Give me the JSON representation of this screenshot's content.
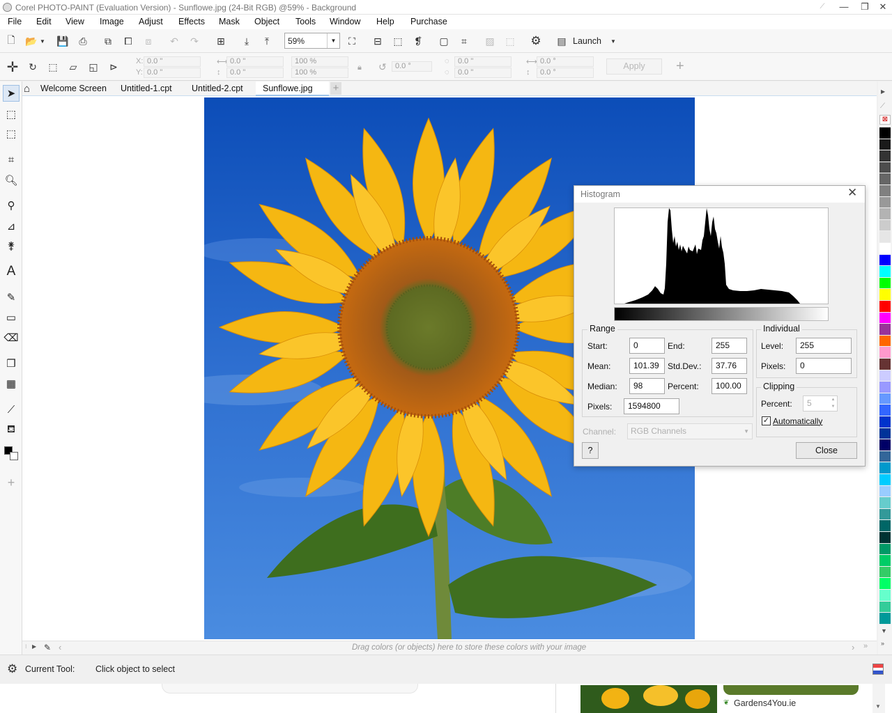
{
  "window": {
    "title": "Corel PHOTO-PAINT (Evaluation Version) - Sunflowe.jpg (24-Bit RGB) @59% - Background"
  },
  "menu": [
    "File",
    "Edit",
    "View",
    "Image",
    "Adjust",
    "Effects",
    "Mask",
    "Object",
    "Tools",
    "Window",
    "Help",
    "Purchase"
  ],
  "toolbar": {
    "zoom": "59%",
    "launch_label": "Launch"
  },
  "propbar": {
    "x": "0.0 \"",
    "y": "0.0 \"",
    "w": "0.0 \"",
    "h": "0.0 \"",
    "scale_w": "100 %",
    "scale_h": "100 %",
    "rotate": "0.0 °",
    "cx": "0.0 \"",
    "cy": "0.0 \"",
    "skew_h": "0.0 °",
    "skew_v": "0.0 °",
    "x_label": "X:",
    "y_label": "Y:",
    "apply_label": "Apply"
  },
  "tabs": [
    "Welcome Screen",
    "Untitled-1.cpt",
    "Untitled-2.cpt",
    "Sunflowe.jpg"
  ],
  "histogram": {
    "title": "Histogram",
    "range_label": "Range",
    "individual_label": "Individual",
    "clipping_label": "Clipping",
    "start_label": "Start:",
    "start": "0",
    "end_label": "End:",
    "end": "255",
    "mean_label": "Mean:",
    "mean": "101.39",
    "stddev_label": "Std.Dev.:",
    "stddev": "37.76",
    "median_label": "Median:",
    "median": "98",
    "percent_label": "Percent:",
    "percent": "100.00",
    "pixels_label": "Pixels:",
    "pixels": "1594800",
    "level_label": "Level:",
    "level": "255",
    "ind_pixels_label": "Pixels:",
    "ind_pixels": "0",
    "clip_percent_label": "Percent:",
    "clip_percent": "5",
    "auto_label": "Automatically",
    "channel_label": "Channel:",
    "channel": "RGB Channels",
    "help_label": "?",
    "close_label": "Close"
  },
  "colortray": {
    "hint": "Drag colors (or objects) here to store these colors with your image"
  },
  "status": {
    "current_tool_label": "Current Tool:",
    "current_tool_value": "Click object to select"
  },
  "thumbnail": {
    "label": "Gardens4You.ie"
  },
  "palette": [
    "#000000",
    "#1a1a1a",
    "#333333",
    "#4d4d4d",
    "#666666",
    "#808080",
    "#999999",
    "#b3b3b3",
    "#cccccc",
    "#e6e6e6",
    "#ffffff",
    "#0000ff",
    "#00ffff",
    "#00ff00",
    "#ffff00",
    "#ff0000",
    "#ff00ff",
    "#993399",
    "#ff6600",
    "#ff99cc",
    "#663333",
    "#ccccff",
    "#9999ff",
    "#6699ff",
    "#3366ff",
    "#0033cc",
    "#003399",
    "#000066",
    "#336699",
    "#0099cc",
    "#00ccff",
    "#99ccff",
    "#66cccc",
    "#339999",
    "#006666",
    "#003333",
    "#009966",
    "#00cc66",
    "#33cc66",
    "#00ff66",
    "#66ffcc",
    "#33cc99",
    "#009999"
  ]
}
